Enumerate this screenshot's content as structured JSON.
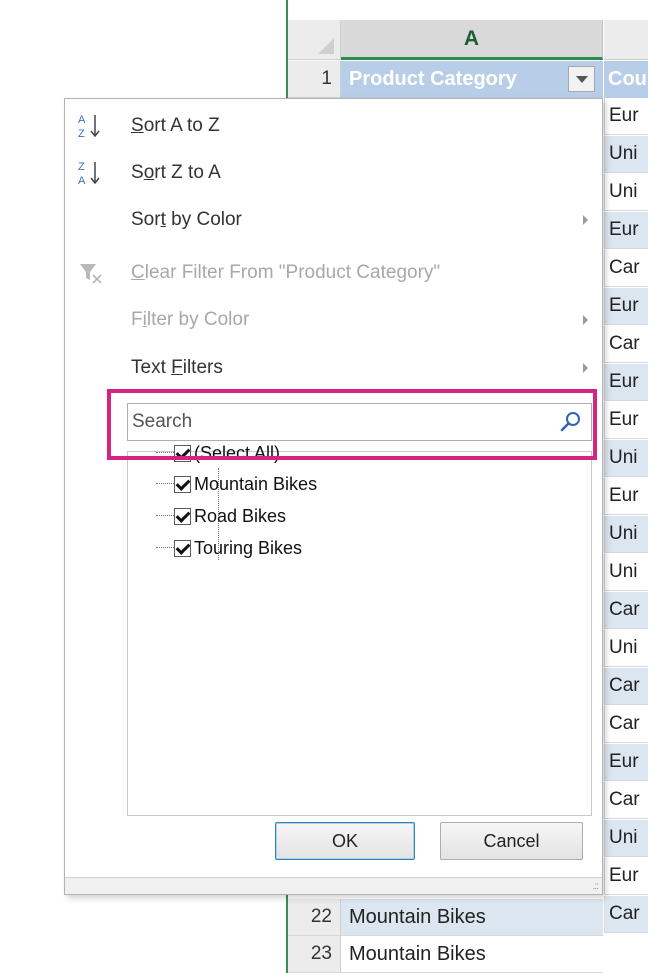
{
  "sheet": {
    "column_header": "A",
    "header_row_number": "1",
    "header_cell_a": "Product Category",
    "header_cell_b": "Cou",
    "column_b_cells": [
      "Eur",
      "Uni",
      "Uni",
      "Eur",
      "Car",
      "Eur",
      "Car",
      "Eur",
      "Eur",
      "Uni",
      "Eur",
      "Uni",
      "Uni",
      "Car",
      "Uni",
      "Car",
      "Car",
      "Eur",
      "Car",
      "Uni",
      "Eur",
      "Car"
    ],
    "bottom_rows": [
      {
        "num": "22",
        "a": "Mountain Bikes"
      },
      {
        "num": "23",
        "a": "Mountain Bikes"
      }
    ]
  },
  "menu": {
    "sort_az": {
      "pre": "",
      "u": "S",
      "post": "ort A to Z",
      "icon": "sort-ascending-icon"
    },
    "sort_za": {
      "pre": "S",
      "u": "o",
      "post": "rt Z to A",
      "icon": "sort-descending-icon"
    },
    "sort_color": {
      "pre": "Sor",
      "u": "t",
      "post": " by Color"
    },
    "clear_filter": {
      "pre": "",
      "u": "C",
      "post": "lear Filter From \"Product Category\"",
      "icon": "clear-filter-icon"
    },
    "filter_color": {
      "pre": "F",
      "u": "i",
      "post": "lter by Color"
    },
    "text_filters": {
      "pre": "Text ",
      "u": "F",
      "post": "ilters"
    }
  },
  "search": {
    "placeholder": "Search",
    "icon": "search-icon"
  },
  "tree": {
    "select_all": "(Select All)",
    "items": [
      "Mountain Bikes",
      "Road Bikes",
      "Touring Bikes"
    ]
  },
  "buttons": {
    "ok": "OK",
    "cancel": "Cancel"
  },
  "colors": {
    "highlight": "#d4247f",
    "header_fill": "#b8cde8",
    "band_fill": "#dce6f1",
    "grid_accent": "#2f8a4f"
  }
}
